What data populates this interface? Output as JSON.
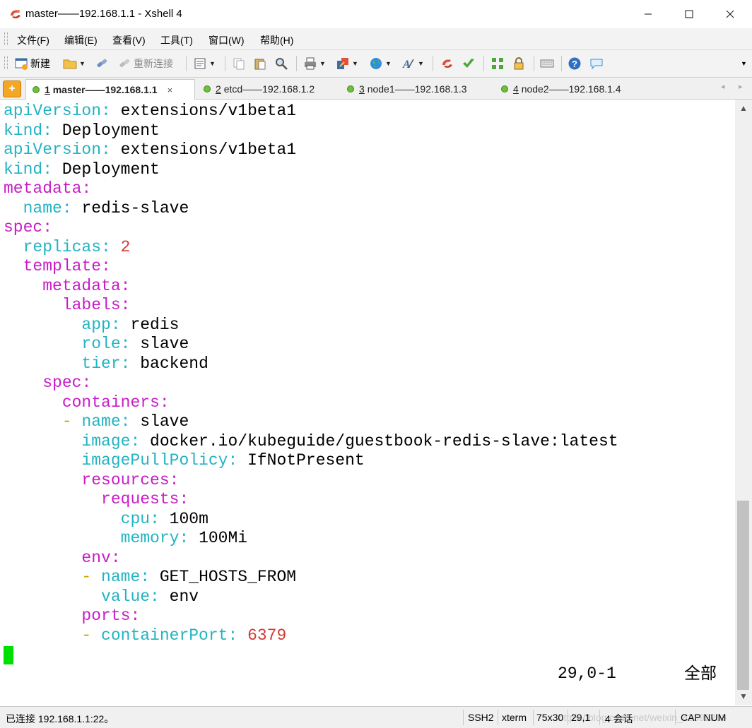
{
  "window": {
    "title": "master——192.168.1.1 - Xshell 4"
  },
  "menu": [
    "文件(F)",
    "编辑(E)",
    "查看(V)",
    "工具(T)",
    "窗口(W)",
    "帮助(H)"
  ],
  "toolbar": {
    "new_label": "新建",
    "reconnect_label": "重新连接"
  },
  "tabs": [
    {
      "num": "1",
      "label": "master——192.168.1.1",
      "active": true
    },
    {
      "num": "2",
      "label": "etcd——192.168.1.2"
    },
    {
      "num": "3",
      "label": "node1——192.168.1.3"
    },
    {
      "num": "4",
      "label": "node2——192.168.1.4"
    }
  ],
  "terminal_lines": [
    [
      "apiVersion",
      ": ",
      "extensions/v1beta1"
    ],
    [
      "kind",
      ": ",
      "Deployment"
    ],
    [
      "apiVersion",
      ": ",
      "extensions/v1beta1"
    ],
    [
      "kind",
      ": ",
      "Deployment"
    ],
    [
      "metadata",
      ":",
      ""
    ],
    [
      "  name",
      ": ",
      "redis-slave"
    ],
    [
      "spec",
      ":",
      ""
    ],
    [
      "  replicas",
      ": ",
      "2"
    ],
    [
      "  template",
      ":",
      ""
    ],
    [
      "    metadata",
      ":",
      ""
    ],
    [
      "      labels",
      ":",
      ""
    ],
    [
      "        app",
      ": ",
      "redis"
    ],
    [
      "        role",
      ": ",
      "slave"
    ],
    [
      "        tier",
      ": ",
      "backend"
    ],
    [
      "    spec",
      ":",
      ""
    ],
    [
      "      containers",
      ":",
      ""
    ],
    [
      "      - name",
      ": ",
      "slave"
    ],
    [
      "        image",
      ": ",
      "docker.io/kubeguide/guestbook-redis-slave:latest"
    ],
    [
      "        imagePullPolicy",
      ": ",
      "IfNotPresent"
    ],
    [
      "        resources",
      ":",
      ""
    ],
    [
      "          requests",
      ":",
      ""
    ],
    [
      "            cpu",
      ": ",
      "100m"
    ],
    [
      "            memory",
      ": ",
      "100Mi"
    ],
    [
      "        env",
      ":",
      ""
    ],
    [
      "        - name",
      ": ",
      "GET_HOSTS_FROM"
    ],
    [
      "          value",
      ": ",
      "env"
    ],
    [
      "        ports",
      ":",
      ""
    ],
    [
      "        - containerPort",
      ": ",
      "6379"
    ]
  ],
  "vim_status": {
    "position": "29,0-1",
    "scroll": "全部"
  },
  "statusbar": {
    "connection": "已连接 192.168.1.1:22。",
    "protocol": "SSH2",
    "term": "xterm",
    "size": "75x30",
    "cursor": "29,1",
    "sessions": "4 会话",
    "caps": "CAP NUM",
    "watermark": "https://blog.csdn.net/weixin_43392206"
  },
  "colors": {
    "key": "#22b3c2",
    "value": "#000000",
    "number": "#d23b30",
    "dash": "#c8a200",
    "cursor": "#00e000"
  }
}
